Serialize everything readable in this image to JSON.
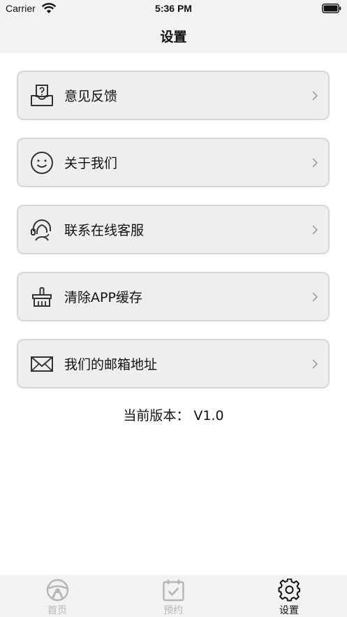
{
  "status_bar": {
    "carrier": "Carrier",
    "time": "5:36 PM"
  },
  "nav": {
    "title": "设置"
  },
  "menu": [
    {
      "label": "意见反馈",
      "icon": "feedback-inbox-question-icon"
    },
    {
      "label": "关于我们",
      "icon": "smile-face-icon"
    },
    {
      "label": "联系在线客服",
      "icon": "headset-support-icon"
    },
    {
      "label": "清除APP缓存",
      "icon": "broom-clean-icon"
    },
    {
      "label": "我们的邮箱地址",
      "icon": "mail-envelope-icon"
    }
  ],
  "version": {
    "text": "当前版本：  V1.0"
  },
  "tabs": [
    {
      "label": "首页",
      "icon": "steering-wheel-icon",
      "active": false
    },
    {
      "label": "预约",
      "icon": "calendar-check-icon",
      "active": false
    },
    {
      "label": "设置",
      "icon": "gear-icon",
      "active": true
    }
  ],
  "colors": {
    "background": "#ffffff",
    "bar": "#f2f2f2",
    "card": "#eeeeee",
    "card_border": "#d5d5d5",
    "tab_inactive": "#b5b5b5",
    "tab_active": "#111111"
  }
}
